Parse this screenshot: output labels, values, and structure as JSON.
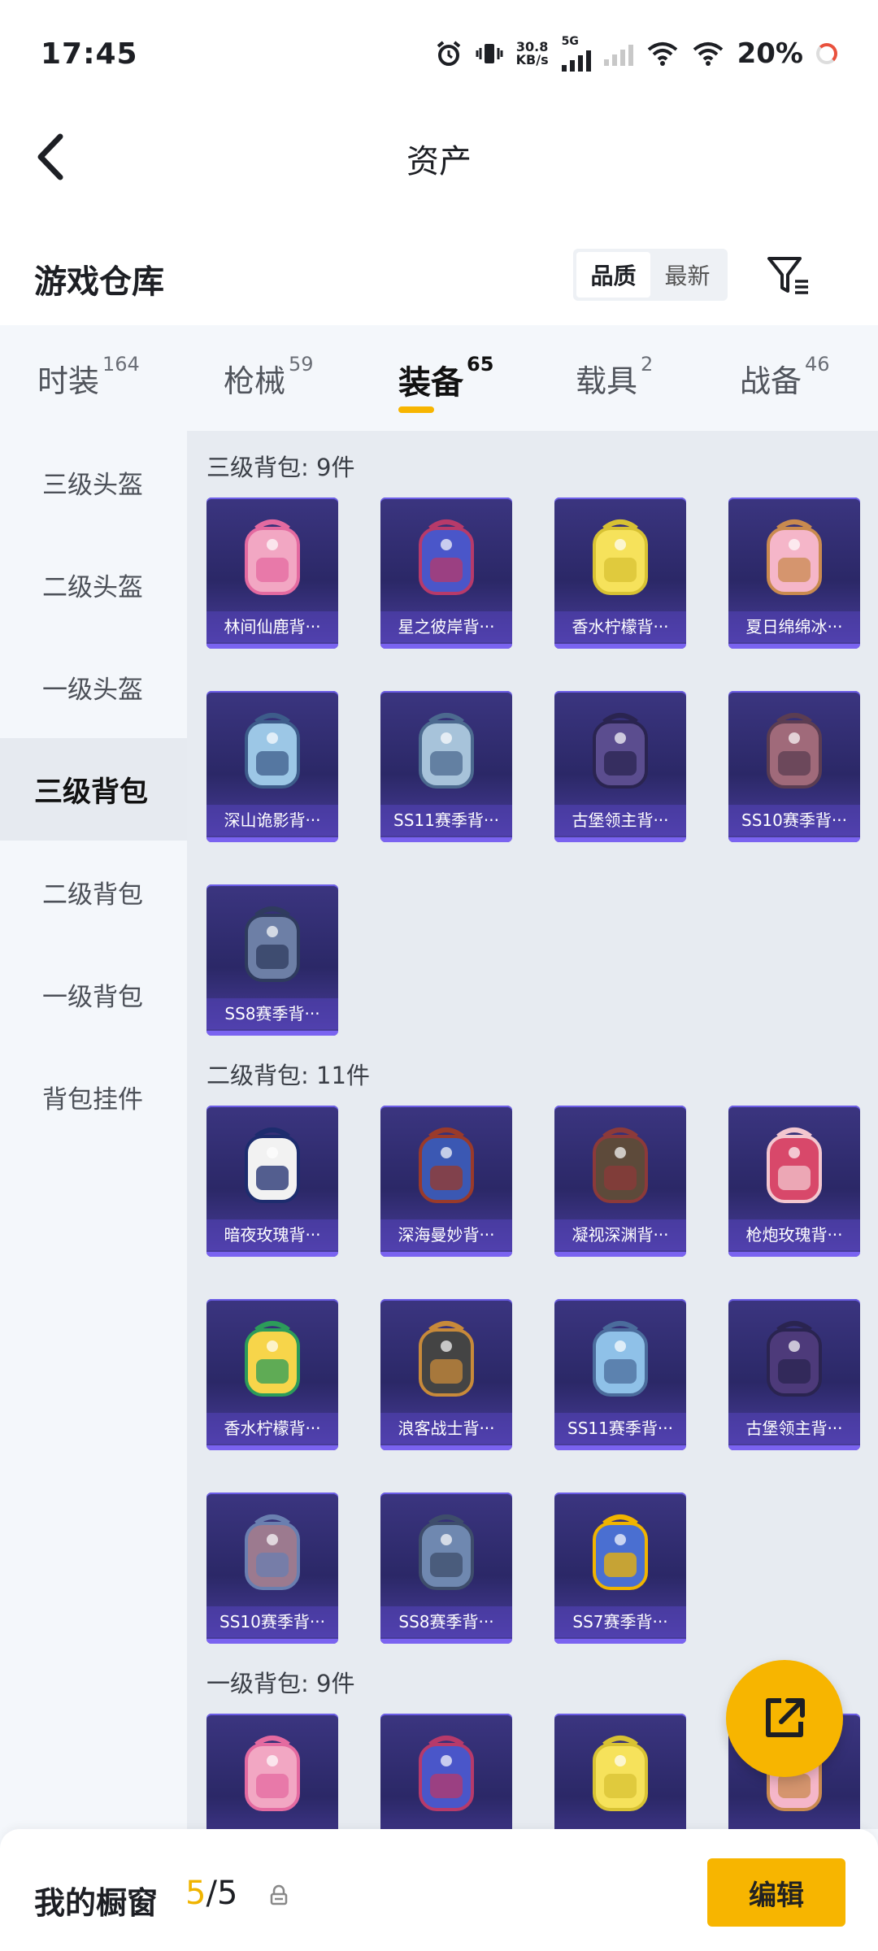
{
  "status": {
    "time": "17:45",
    "net_speed_top": "30.8",
    "net_speed_bottom": "KB/s",
    "network_type": "5G",
    "battery": "20%"
  },
  "header": {
    "title": "资产",
    "back_icon": "chevron-left-icon"
  },
  "subheader": {
    "title": "游戏仓库",
    "sort_options": [
      "品质",
      "最新"
    ],
    "sort_selected": "品质",
    "filter_icon": "filter-icon"
  },
  "tabs": [
    {
      "label": "时装",
      "count": "164"
    },
    {
      "label": "枪械",
      "count": "59"
    },
    {
      "label": "装备",
      "count": "65",
      "active": true
    },
    {
      "label": "载具",
      "count": "2"
    },
    {
      "label": "战备",
      "count": "46"
    }
  ],
  "sidebar": [
    {
      "label": "三级头盔"
    },
    {
      "label": "二级头盔"
    },
    {
      "label": "一级头盔"
    },
    {
      "label": "三级背包",
      "active": true
    },
    {
      "label": "二级背包"
    },
    {
      "label": "一级背包"
    },
    {
      "label": "背包挂件"
    }
  ],
  "sections": [
    {
      "title": "三级背包: 9件",
      "items": [
        "林间仙鹿背···",
        "星之彼岸背···",
        "香水柠檬背···",
        "夏日绵绵冰···",
        "深山诡影背···",
        "SS11赛季背···",
        "古堡领主背···",
        "SS10赛季背···",
        "SS8赛季背···"
      ]
    },
    {
      "title": "二级背包: 11件",
      "items": [
        "暗夜玫瑰背···",
        "深海曼妙背···",
        "凝视深渊背···",
        "枪炮玫瑰背···",
        "香水柠檬背···",
        "浪客战士背···",
        "SS11赛季背···",
        "古堡领主背···",
        "SS10赛季背···",
        "SS8赛季背···",
        "SS7赛季背···"
      ]
    },
    {
      "title": "一级背包: 9件",
      "items": [
        "",
        "",
        "",
        ""
      ]
    }
  ],
  "colors": {
    "accent": "#f7b500",
    "card_bg": "#2b2867",
    "card_border": "#7a63f0"
  },
  "fab_icon": "share-external-icon",
  "bottom": {
    "label": "我的橱窗",
    "count_current": "5",
    "count_sep": "/",
    "count_total": "5",
    "lock_icon": "lock-icon",
    "edit_label": "编辑"
  }
}
